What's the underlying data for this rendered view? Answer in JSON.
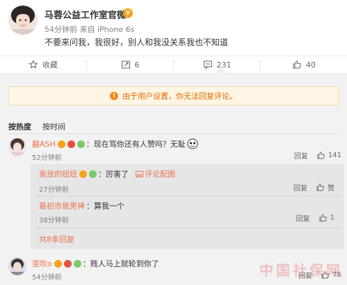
{
  "post": {
    "author": "马蓉公益工作室官微",
    "time": "54分钟前",
    "source": "来自 iPhone 6s",
    "text": "不要来问我，我很好，别人和我没关系我也不知道"
  },
  "actions": {
    "collect_label": "收藏",
    "repost_count": "6",
    "comment_count": "231",
    "like_count": "40"
  },
  "notice": "由于用户设置，你无法回复评论。",
  "sort": {
    "hot": "按热度",
    "time": "按时间"
  },
  "comments": [
    {
      "user": "囍ASH",
      "text": "：现在骂你还有人赞吗？无耻",
      "time": "52分钟前",
      "reply_label": "回复",
      "like_count": "141",
      "replies": [
        {
          "user": "豪放的妞妞",
          "text": "：厉害了",
          "tag": "评论配图",
          "time": "27分钟前",
          "reply_label": "回复",
          "like_label": "赞"
        },
        {
          "user": "最初亦是男神",
          "text": "：算我一个",
          "time": "38分钟前",
          "reply_label": "回复",
          "like_count": "1"
        }
      ],
      "more_replies": "共8条回复"
    },
    {
      "user": "雯吹o",
      "text": "：贱人马上就轮到你了",
      "time": "54分钟前",
      "reply_label": "回复",
      "like_count": "76"
    }
  ],
  "watermark": "中国社保网",
  "colors": {
    "accent": "#eb7350",
    "notice_bg": "#fff5e5",
    "notice_text": "#e46b00"
  }
}
